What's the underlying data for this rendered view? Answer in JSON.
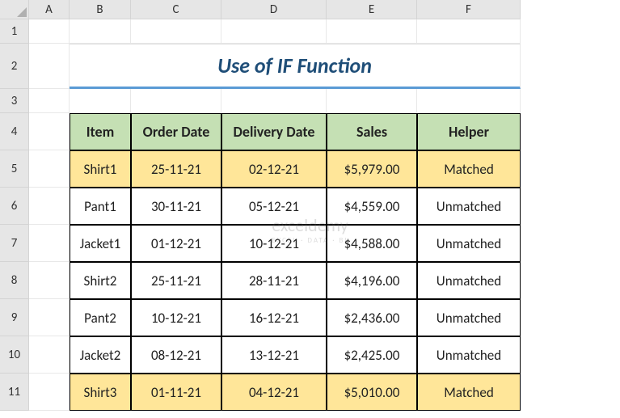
{
  "columns": [
    "A",
    "B",
    "C",
    "D",
    "E",
    "F"
  ],
  "rows": [
    "1",
    "2",
    "3",
    "4",
    "5",
    "6",
    "7",
    "8",
    "9",
    "10",
    "11"
  ],
  "title": "Use of IF Function",
  "table": {
    "headers": [
      "Item",
      "Order Date",
      "Delivery Date",
      "Sales",
      "Helper"
    ],
    "data": [
      {
        "item": "Shirt1",
        "order": "25-11-21",
        "delivery": "02-12-21",
        "sales": "$5,979.00",
        "helper": "Matched",
        "hl": true
      },
      {
        "item": "Pant1",
        "order": "30-11-21",
        "delivery": "05-12-21",
        "sales": "$4,559.00",
        "helper": "Unmatched",
        "hl": false
      },
      {
        "item": "Jacket1",
        "order": "01-12-21",
        "delivery": "10-12-21",
        "sales": "$4,588.00",
        "helper": "Unmatched",
        "hl": false
      },
      {
        "item": "Shirt2",
        "order": "25-11-21",
        "delivery": "28-11-21",
        "sales": "$4,196.00",
        "helper": "Unmatched",
        "hl": false
      },
      {
        "item": "Pant2",
        "order": "10-12-21",
        "delivery": "16-12-21",
        "sales": "$2,436.00",
        "helper": "Unmatched",
        "hl": false
      },
      {
        "item": "Jacket2",
        "order": "08-12-21",
        "delivery": "13-12-21",
        "sales": "$2,425.00",
        "helper": "Unmatched",
        "hl": false
      },
      {
        "item": "Shirt3",
        "order": "01-11-21",
        "delivery": "04-12-21",
        "sales": "$5,010.00",
        "helper": "Matched",
        "hl": true
      }
    ]
  },
  "watermark": {
    "main": "exceldemy",
    "sub": "EXCEL · DATA · BI"
  },
  "chart_data": {
    "type": "table",
    "title": "Use of IF Function",
    "columns": [
      "Item",
      "Order Date",
      "Delivery Date",
      "Sales",
      "Helper"
    ],
    "rows": [
      [
        "Shirt1",
        "25-11-21",
        "02-12-21",
        5979.0,
        "Matched"
      ],
      [
        "Pant1",
        "30-11-21",
        "05-12-21",
        4559.0,
        "Unmatched"
      ],
      [
        "Jacket1",
        "01-12-21",
        "10-12-21",
        4588.0,
        "Unmatched"
      ],
      [
        "Shirt2",
        "25-11-21",
        "28-11-21",
        4196.0,
        "Unmatched"
      ],
      [
        "Pant2",
        "10-12-21",
        "16-12-21",
        2436.0,
        "Unmatched"
      ],
      [
        "Jacket2",
        "08-12-21",
        "13-12-21",
        2425.0,
        "Unmatched"
      ],
      [
        "Shirt3",
        "01-11-21",
        "04-12-21",
        5010.0,
        "Matched"
      ]
    ]
  }
}
